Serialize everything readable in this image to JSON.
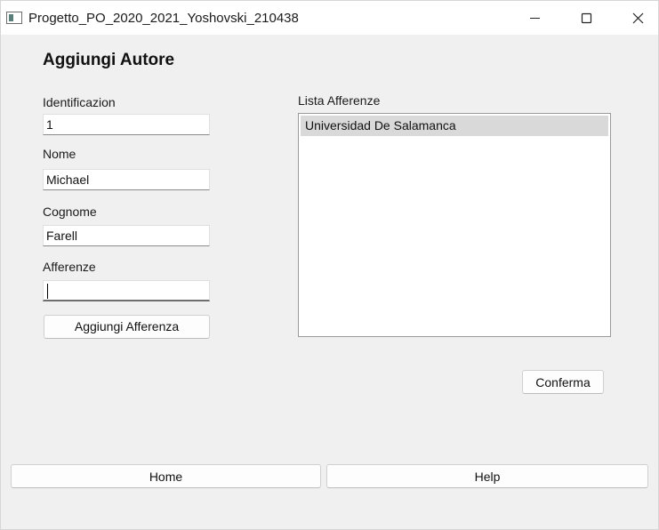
{
  "window": {
    "title": "Progetto_PO_2020_2021_Yoshovski_210438",
    "controls": [
      "minimize-icon",
      "maximize-icon",
      "close-icon"
    ]
  },
  "form": {
    "heading": "Aggiungi Autore",
    "identificazione": {
      "label": "Identificazion",
      "value": "1"
    },
    "nome": {
      "label": "Nome",
      "value": "Michael"
    },
    "cognome": {
      "label": "Cognome",
      "value": "Farell"
    },
    "afferenze": {
      "label": "Afferenze",
      "value": ""
    },
    "add_affiliation_label": "Aggiungi Afferenza"
  },
  "list": {
    "label": "Lista Afferenze",
    "items": [
      "Universidad De Salamanca"
    ],
    "selected_index": 0
  },
  "confirm_label": "Conferma",
  "footer": {
    "home_label": "Home",
    "help_label": "Help"
  },
  "colors": {
    "window_bg": "#f0f0f0",
    "titlebar_bg": "#ffffff",
    "selected_item_bg": "#d9d9d9"
  }
}
